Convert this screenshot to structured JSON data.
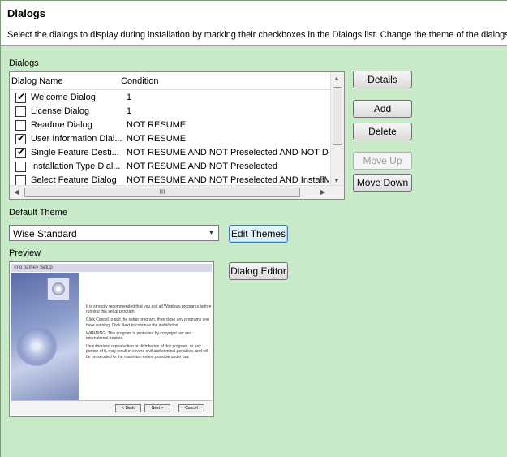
{
  "header": {
    "title": "Dialogs",
    "description": "Select the dialogs to display during installation by marking their checkboxes in the Dialogs list. Change the theme of the dialogs by s"
  },
  "dialogs_section": {
    "label": "Dialogs",
    "columns": [
      "Dialog Name",
      "Condition"
    ],
    "rows": [
      {
        "checked": true,
        "name": "Welcome Dialog",
        "condition": "1"
      },
      {
        "checked": false,
        "name": "License Dialog",
        "condition": "1"
      },
      {
        "checked": false,
        "name": "Readme Dialog",
        "condition": "NOT RESUME"
      },
      {
        "checked": true,
        "name": "User Information Dial...",
        "condition": "NOT RESUME"
      },
      {
        "checked": true,
        "name": "Single Feature Desti...",
        "condition": "NOT RESUME AND NOT Preselected AND NOT Di..."
      },
      {
        "checked": false,
        "name": "Installation Type Dial...",
        "condition": "NOT RESUME AND NOT Preselected"
      },
      {
        "checked": false,
        "name": "Select Feature Dialog",
        "condition": "NOT RESUME AND NOT Preselected AND InstallM..."
      }
    ],
    "scroll_grip": "III"
  },
  "buttons": {
    "details": "Details",
    "add": "Add",
    "delete": "Delete",
    "move_up": "Move Up",
    "move_down": "Move Down",
    "edit_themes": "Edit Themes",
    "dialog_editor": "Dialog Editor"
  },
  "theme": {
    "label": "Default Theme",
    "selected": "Wise Standard"
  },
  "preview": {
    "label": "Preview",
    "window_title": "<no name> Setup",
    "paragraphs": [
      "It is strongly recommended that you exit all Windows programs before running this setup program.",
      "Click Cancel to quit the setup program, then close any programs you have running. Click Next to continue the installation.",
      "WARNING: This program is protected by copyright law and international treaties.",
      "Unauthorized reproduction or distribution of this program, or any portion of it, may result in severe civil and criminal penalties, and will be prosecuted to the maximum extent possible under law."
    ],
    "back_label": "< Back",
    "next_label": "Next >",
    "cancel_label": "Cancel"
  }
}
